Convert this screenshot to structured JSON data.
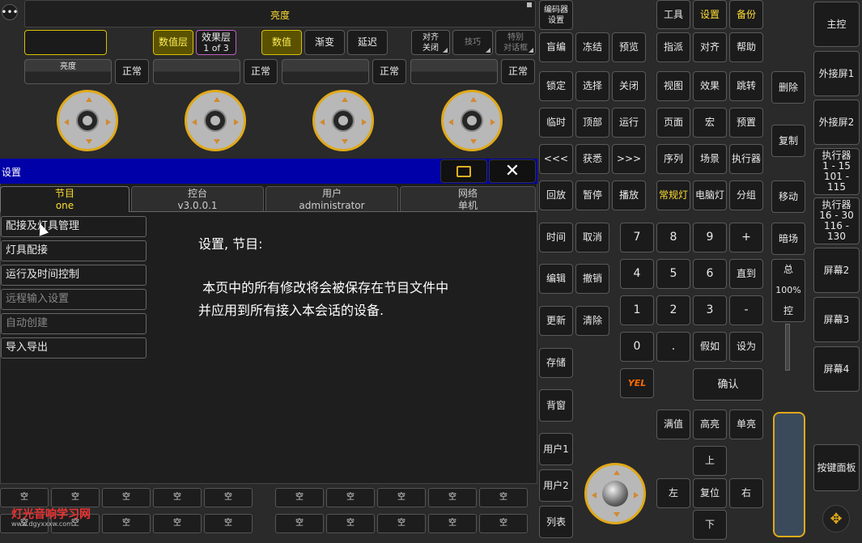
{
  "top": {
    "title": "亮度",
    "layer_buttons": [
      "数值层",
      "效果层",
      "1 of 3",
      "数值",
      "渐变",
      "延迟"
    ],
    "align": [
      "对齐",
      "关闭"
    ],
    "tricks": "技巧",
    "special": [
      "特别",
      "对话框"
    ],
    "encoders": [
      {
        "label": "亮度",
        "mode": "正常"
      },
      {
        "label": "",
        "mode": "正常"
      },
      {
        "label": "",
        "mode": "正常"
      },
      {
        "label": "",
        "mode": "正常"
      }
    ]
  },
  "settings": {
    "title": "设置",
    "tabs": [
      {
        "top": "节目",
        "bottom": "one"
      },
      {
        "top": "控台",
        "bottom": "v3.0.0.1"
      },
      {
        "top": "用户",
        "bottom": "administrator"
      },
      {
        "top": "网络",
        "bottom": "单机"
      }
    ],
    "menu": [
      "配接及灯具管理",
      "灯具配接",
      "运行及时间控制",
      "远程输入设置",
      "自动创建",
      "导入导出"
    ],
    "content_title": "设置, 节目:",
    "content_line1": " 本页中的所有修改将会被保存在节目文件中",
    "content_line2": "并应用到所有接入本会话的设备."
  },
  "executors": {
    "empty_label": "空"
  },
  "watermark": {
    "text": "灯光音响学习网",
    "url": "www.dgyxxxw.com"
  },
  "col1": [
    "编码器设置",
    "盲编",
    "锁定",
    "临时",
    "<<<",
    "回放",
    "时间",
    "编辑",
    "更新",
    "存储",
    "背窗",
    "用户1",
    "用户2",
    "列表"
  ],
  "col2": [
    "冻结",
    "选择",
    "顶部",
    "获悉",
    "暂停",
    "取消",
    "撤销",
    "清除"
  ],
  "col3": [
    "预览",
    "关闭",
    "运行",
    ">>>",
    "播放"
  ],
  "top_right": [
    "工具",
    "设置",
    "备份"
  ],
  "grid_right": [
    "指派",
    "对齐",
    "帮助",
    "视图",
    "效果",
    "跳转",
    "页面",
    "宏",
    "预置",
    "序列",
    "场景",
    "执行器",
    "常规灯",
    "电脑灯",
    "分组"
  ],
  "keypad": [
    "7",
    "8",
    "9",
    "+",
    "4",
    "5",
    "6",
    "直到",
    "1",
    "2",
    "3",
    "-",
    "0",
    ".",
    "假如",
    "设为"
  ],
  "yel": "YEL",
  "confirm": "确认",
  "levels": [
    "满值",
    "高亮",
    "单亮"
  ],
  "arrows": {
    "up": "上",
    "left": "左",
    "reset": "复位",
    "right": "右",
    "down": "下"
  },
  "side": [
    "删除",
    "复制",
    "移动",
    "暗场"
  ],
  "master": {
    "top": "总",
    "value": "100%",
    "bottom": "控"
  },
  "far_right": {
    "main": "主控",
    "ext1": "外接屏1",
    "ext2": "外接屏2",
    "exec1": [
      "执行器",
      "1 - 15",
      "101 - 115"
    ],
    "exec2": [
      "执行器",
      "16 - 30",
      "116 - 130"
    ],
    "screen2": "屏幕2",
    "screen3": "屏幕3",
    "screen4": "屏幕4",
    "keyboard": "按键面板"
  },
  "colors": {
    "accent": "#ffdd33",
    "header": "#0000a8",
    "knob_ring": "#e0a91a"
  }
}
